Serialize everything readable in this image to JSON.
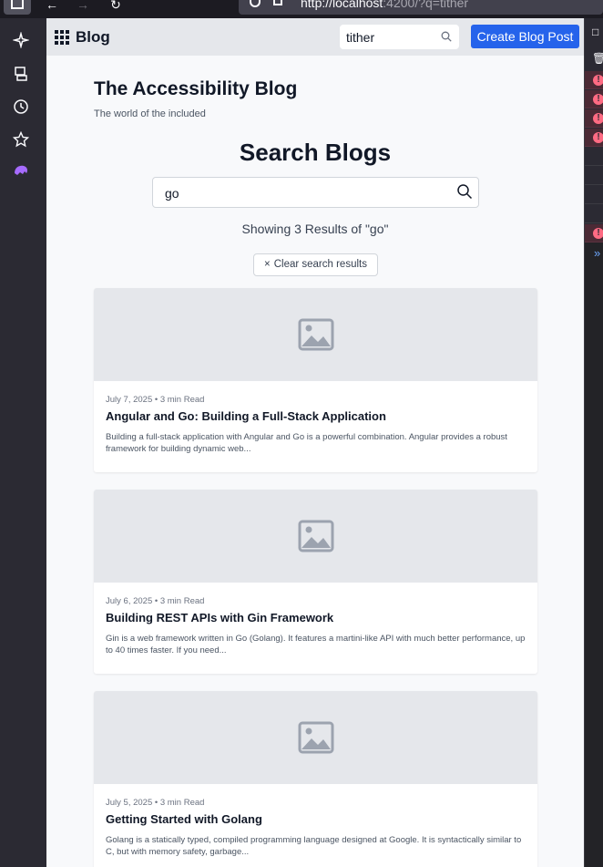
{
  "browser": {
    "url_host": "http://localhost",
    "url_rest": ":4200/?q=tither"
  },
  "left_rail": {
    "icons": [
      "sparkle-icon",
      "sync-icon",
      "history-icon",
      "bookmark-star-icon",
      "extension-icon"
    ]
  },
  "navbar": {
    "brand": "Blog",
    "search_value": "tither",
    "create_button": "Create Blog Post"
  },
  "header": {
    "title": "The Accessibility Blog",
    "tagline": "The world of the included"
  },
  "search": {
    "heading": "Search Blogs",
    "query": "go",
    "results_summary": "Showing 3 Results of \"go\"",
    "clear_label": "Clear search results"
  },
  "posts": [
    {
      "meta": "July 7, 2025 • 3 min Read",
      "title": "Angular and Go: Building a Full-Stack Application",
      "excerpt": "Building a full-stack application with Angular and Go is a powerful combination. Angular provides a robust framework for building dynamic web..."
    },
    {
      "meta": "July 6, 2025 • 3 min Read",
      "title": "Building REST APIs with Gin Framework",
      "excerpt": "Gin is a web framework written in Go (Golang). It features a martini-like API with much better performance, up to 40 times faster. If you need..."
    },
    {
      "meta": "July 5, 2025 • 3 min Read",
      "title": "Getting Started with Golang",
      "excerpt": "Golang is a statically typed, compiled programming language designed at Google. It is syntactically similar to C, but with memory safety, garbage..."
    }
  ],
  "colors": {
    "primary": "#2563eb",
    "navbar_bg": "#e5e7eb",
    "page_bg": "#f8f9fb",
    "error": "#ff6b83"
  }
}
